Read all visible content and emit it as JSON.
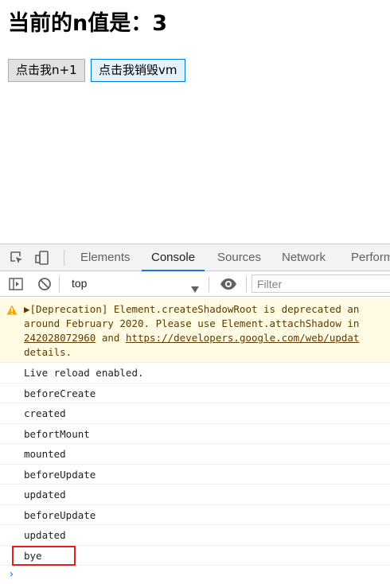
{
  "page": {
    "heading": "当前的n值是：3",
    "buttons": [
      {
        "label": "点击我n+1"
      },
      {
        "label": "点击我销毁vm"
      }
    ]
  },
  "devtools": {
    "tabs": [
      "Elements",
      "Console",
      "Sources",
      "Network",
      "Perform"
    ],
    "active_tab": "Console",
    "toolbar": {
      "context": "top",
      "filter_placeholder": "Filter"
    },
    "warning": {
      "line1_prefix": "[Deprecation] Element.createShadowRoot is deprecated an",
      "line2": "around February 2020. Please use Element.attachShadow in",
      "line3_link1": "242028072960",
      "line3_and": " and ",
      "line3_link2": "https://developers.google.com/web/updat",
      "line4": "details."
    },
    "messages": [
      "Live reload enabled.",
      "beforeCreate",
      "created",
      "befortMount",
      "mounted",
      "beforeUpdate",
      "updated",
      "beforeUpdate",
      "updated",
      "bye"
    ],
    "prompt": "›"
  },
  "colors": {
    "accent": "#1a73e8",
    "warning_bg": "#fffbe5",
    "warning_text": "#5c3c00",
    "highlight": "#e0201c"
  }
}
